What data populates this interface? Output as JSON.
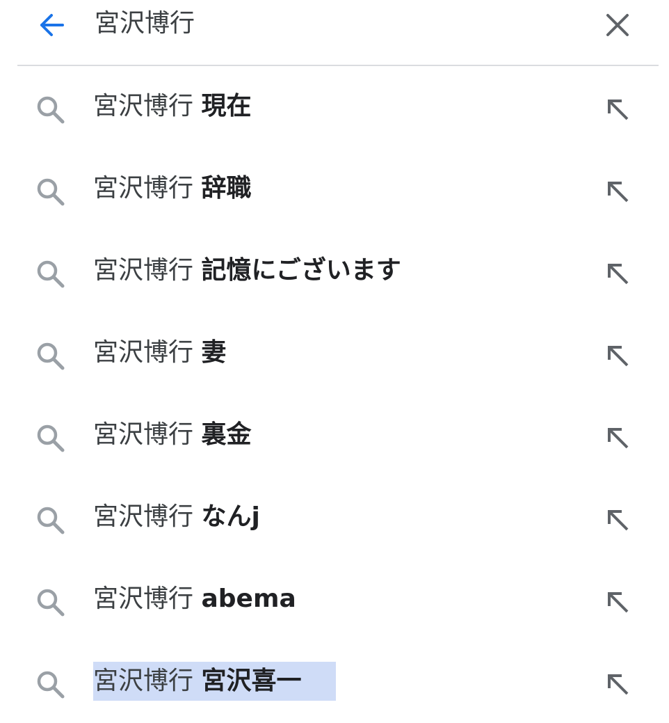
{
  "search": {
    "query": "宮沢博行"
  },
  "suggestions": [
    {
      "prefix": "宮沢博行",
      "suffix": "現在"
    },
    {
      "prefix": "宮沢博行",
      "suffix": "辞職"
    },
    {
      "prefix": "宮沢博行",
      "suffix": "記憶にございます"
    },
    {
      "prefix": "宮沢博行",
      "suffix": "妻"
    },
    {
      "prefix": "宮沢博行",
      "suffix": "裏金"
    },
    {
      "prefix": "宮沢博行",
      "suffix": "なんj"
    },
    {
      "prefix": "宮沢博行",
      "suffix": "abema"
    },
    {
      "prefix": "宮沢博行",
      "suffix": "宮沢喜一",
      "selected": true
    }
  ],
  "icons": {
    "back": "arrow-back-icon",
    "clear": "close-icon",
    "suggestion": "search-icon",
    "fill": "arrow-up-left-icon"
  },
  "colors": {
    "accent": "#1a73e8",
    "icon_gray": "#9aa0a6",
    "dark_icon": "#5f6368",
    "divider": "#dadce0",
    "selection": "#cfdcf7"
  }
}
